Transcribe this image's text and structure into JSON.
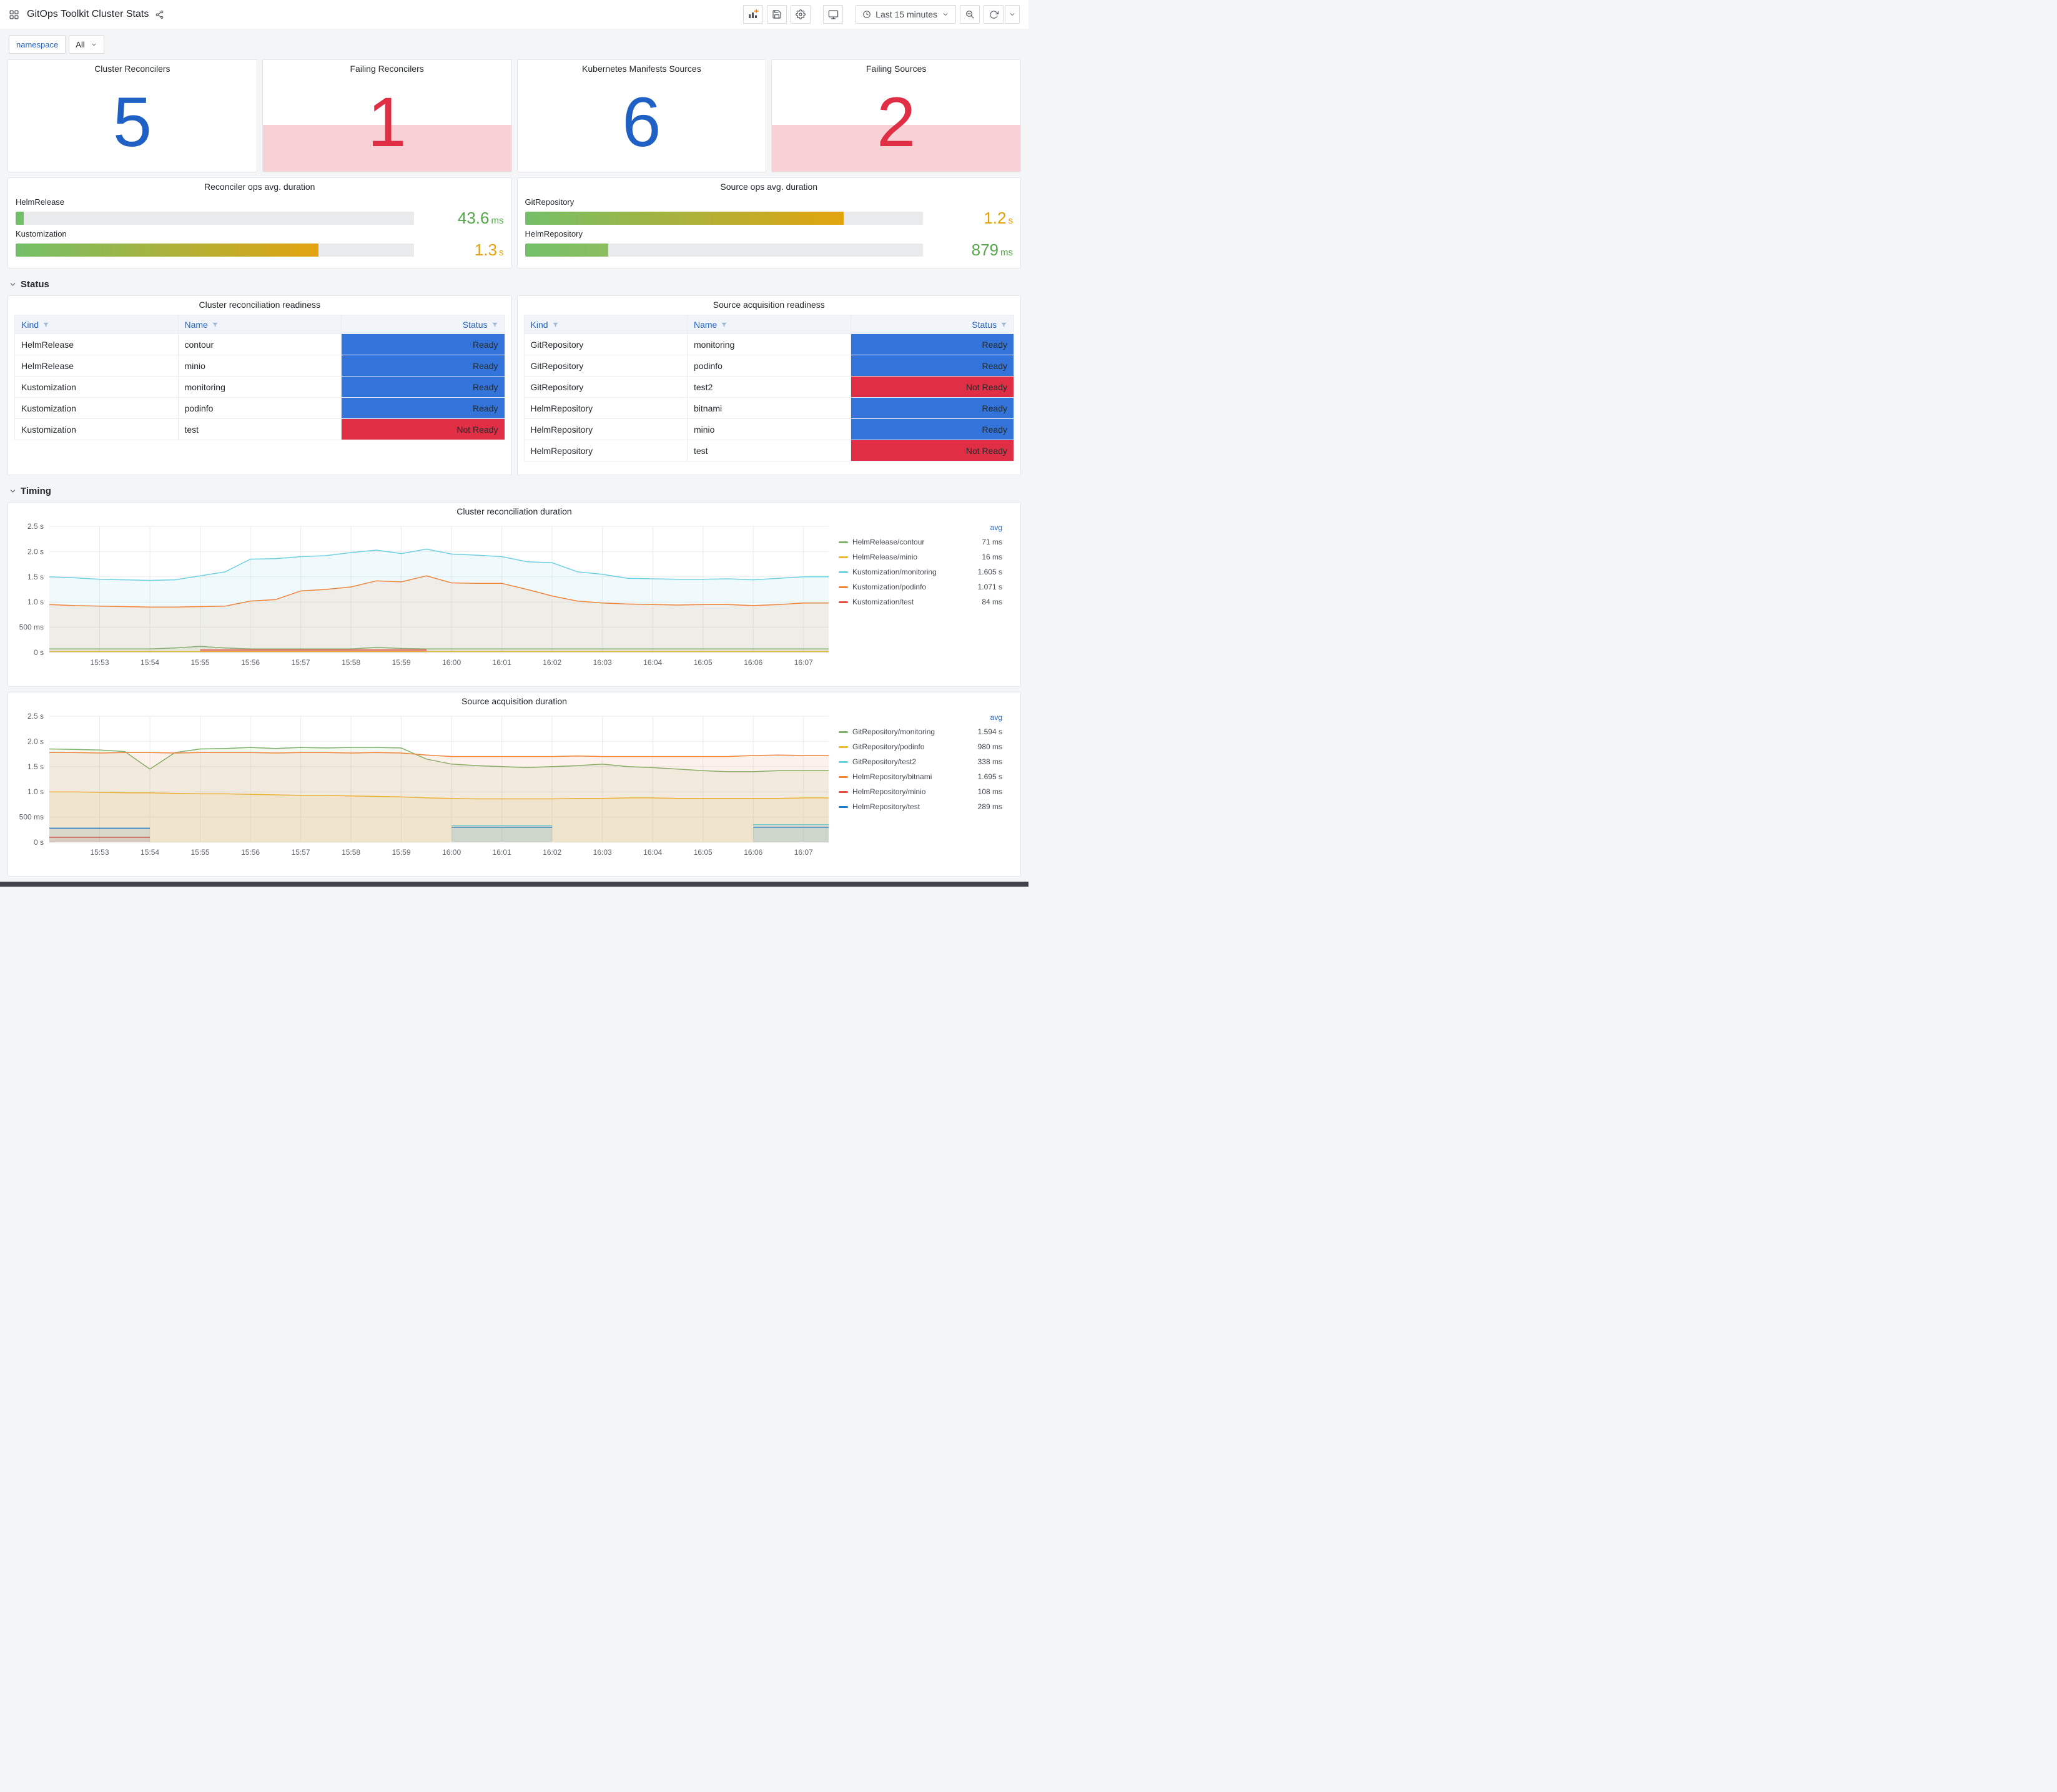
{
  "header": {
    "title": "GitOps Toolkit Cluster Stats",
    "time_range": "Last 15 minutes"
  },
  "variables": {
    "label": "namespace",
    "value": "All"
  },
  "sections": {
    "status": "Status",
    "timing": "Timing"
  },
  "colors": {
    "blue": "#1F60C4",
    "red": "#E02F44",
    "alert_band": "rgba(224,47,68,0.22)",
    "ready": "#3274D9",
    "not_ready": "#E02F44",
    "link_blue": "#1F62C4"
  },
  "stat_panels": [
    {
      "title": "Cluster Reconcilers",
      "value": "5",
      "status": "ok"
    },
    {
      "title": "Failing Reconcilers",
      "value": "1",
      "status": "alert"
    },
    {
      "title": "Kubernetes Manifests Sources",
      "value": "6",
      "status": "ok"
    },
    {
      "title": "Failing Sources",
      "value": "2",
      "status": "alert"
    }
  ],
  "gauge_panels": [
    {
      "title": "Reconciler ops avg. duration",
      "rows": [
        {
          "label": "HelmRelease",
          "value": "43.6",
          "unit": "ms",
          "percent": 2,
          "value_color": "#56A64B",
          "fill_from": "#73BF69",
          "fill_to": "#73BF69"
        },
        {
          "label": "Kustomization",
          "value": "1.3",
          "unit": "s",
          "percent": 76,
          "value_color": "#E5A10D",
          "fill_from": "#73BF69",
          "fill_to": "#E2A40E"
        }
      ]
    },
    {
      "title": "Source ops avg. duration",
      "rows": [
        {
          "label": "GitRepository",
          "value": "1.2",
          "unit": "s",
          "percent": 80,
          "value_color": "#E5A10D",
          "fill_from": "#73BF69",
          "fill_to": "#E2A40E"
        },
        {
          "label": "HelmRepository",
          "value": "879",
          "unit": "ms",
          "percent": 21,
          "value_color": "#56A64B",
          "fill_from": "#73BF69",
          "fill_to": "#8CBE5F"
        }
      ]
    }
  ],
  "tables": [
    {
      "title": "Cluster reconciliation readiness",
      "columns": [
        "Kind",
        "Name",
        "Status"
      ],
      "rows": [
        {
          "kind": "HelmRelease",
          "name": "contour",
          "status": "Ready"
        },
        {
          "kind": "HelmRelease",
          "name": "minio",
          "status": "Ready"
        },
        {
          "kind": "Kustomization",
          "name": "monitoring",
          "status": "Ready"
        },
        {
          "kind": "Kustomization",
          "name": "podinfo",
          "status": "Ready"
        },
        {
          "kind": "Kustomization",
          "name": "test",
          "status": "Not Ready"
        }
      ]
    },
    {
      "title": "Source acquisition readiness",
      "columns": [
        "Kind",
        "Name",
        "Status"
      ],
      "rows": [
        {
          "kind": "GitRepository",
          "name": "monitoring",
          "status": "Ready"
        },
        {
          "kind": "GitRepository",
          "name": "podinfo",
          "status": "Ready"
        },
        {
          "kind": "GitRepository",
          "name": "test2",
          "status": "Not Ready"
        },
        {
          "kind": "HelmRepository",
          "name": "bitnami",
          "status": "Ready"
        },
        {
          "kind": "HelmRepository",
          "name": "minio",
          "status": "Ready"
        },
        {
          "kind": "HelmRepository",
          "name": "test",
          "status": "Not Ready"
        }
      ]
    }
  ],
  "chart_data": [
    {
      "type": "line",
      "title": "Cluster reconciliation duration",
      "xlabel": "",
      "ylabel": "",
      "ylim": [
        0,
        2.5
      ],
      "x_span": 15.5,
      "x_first_tick": 1,
      "legend_header": "avg",
      "y_ticks": [
        {
          "v": 0,
          "label": "0 s"
        },
        {
          "v": 0.5,
          "label": "500 ms"
        },
        {
          "v": 1,
          "label": "1.0 s"
        },
        {
          "v": 1.5,
          "label": "1.5 s"
        },
        {
          "v": 2,
          "label": "2.0 s"
        },
        {
          "v": 2.5,
          "label": "2.5 s"
        }
      ],
      "x_ticks": [
        "15:53",
        "15:54",
        "15:55",
        "15:56",
        "15:57",
        "15:58",
        "15:59",
        "16:00",
        "16:01",
        "16:02",
        "16:03",
        "16:04",
        "16:05",
        "16:06",
        "16:07"
      ],
      "series": [
        {
          "name": "HelmRelease/contour",
          "avg": "71 ms",
          "color": "#7EB26D",
          "values": [
            0.07,
            0.07,
            0.07,
            0.07,
            0.07,
            0.09,
            0.12,
            0.09,
            0.07,
            0.07,
            0.07,
            0.07,
            0.07,
            0.1,
            0.08,
            0.07,
            0.07,
            0.07,
            0.07,
            0.07,
            0.07,
            0.07,
            0.07,
            0.07,
            0.07,
            0.07,
            0.07,
            0.07,
            0.07,
            0.07,
            0.07,
            0.07
          ]
        },
        {
          "name": "HelmRelease/minio",
          "avg": "16 ms",
          "color": "#EAB839",
          "values": [
            0.02,
            0.02,
            0.02,
            0.02,
            0.02,
            0.02,
            0.02,
            0.02,
            0.02,
            0.02,
            0.02,
            0.02,
            0.02,
            0.02,
            0.02,
            0.02,
            0.02,
            0.02,
            0.02,
            0.02,
            0.02,
            0.02,
            0.02,
            0.02,
            0.02,
            0.02,
            0.02,
            0.02,
            0.02,
            0.02,
            0.02,
            0.02
          ]
        },
        {
          "name": "Kustomization/monitoring",
          "avg": "1.605 s",
          "color": "#6ED0E0",
          "values": [
            1.5,
            1.48,
            1.45,
            1.44,
            1.43,
            1.44,
            1.52,
            1.6,
            1.85,
            1.86,
            1.9,
            1.92,
            1.98,
            2.03,
            1.96,
            2.05,
            1.95,
            1.93,
            1.9,
            1.8,
            1.78,
            1.6,
            1.55,
            1.47,
            1.46,
            1.45,
            1.45,
            1.46,
            1.44,
            1.47,
            1.5,
            1.5
          ]
        },
        {
          "name": "Kustomization/podinfo",
          "avg": "1.071 s",
          "color": "#EF843C",
          "values": [
            0.95,
            0.93,
            0.92,
            0.91,
            0.9,
            0.9,
            0.91,
            0.92,
            1.02,
            1.05,
            1.22,
            1.25,
            1.3,
            1.42,
            1.4,
            1.52,
            1.38,
            1.37,
            1.37,
            1.25,
            1.12,
            1.02,
            0.98,
            0.96,
            0.95,
            0.94,
            0.95,
            0.95,
            0.93,
            0.95,
            0.98,
            0.98
          ]
        },
        {
          "name": "Kustomization/test",
          "avg": "84 ms",
          "color": "#E24D42",
          "values": [
            null,
            null,
            null,
            null,
            null,
            null,
            0.05,
            0.05,
            0.05,
            0.05,
            0.05,
            0.05,
            0.05,
            0.05,
            0.05,
            0.05,
            null,
            null,
            null,
            null,
            null,
            null,
            null,
            null,
            null,
            null,
            null,
            null,
            null,
            null,
            null,
            null
          ]
        }
      ]
    },
    {
      "type": "line",
      "title": "Source acquisition duration",
      "xlabel": "",
      "ylabel": "",
      "ylim": [
        0,
        2.5
      ],
      "x_span": 15.5,
      "x_first_tick": 1,
      "legend_header": "avg",
      "y_ticks": [
        {
          "v": 0,
          "label": "0 s"
        },
        {
          "v": 0.5,
          "label": "500 ms"
        },
        {
          "v": 1,
          "label": "1.0 s"
        },
        {
          "v": 1.5,
          "label": "1.5 s"
        },
        {
          "v": 2,
          "label": "2.0 s"
        },
        {
          "v": 2.5,
          "label": "2.5 s"
        }
      ],
      "x_ticks": [
        "15:53",
        "15:54",
        "15:55",
        "15:56",
        "15:57",
        "15:58",
        "15:59",
        "16:00",
        "16:01",
        "16:02",
        "16:03",
        "16:04",
        "16:05",
        "16:06",
        "16:07"
      ],
      "series": [
        {
          "name": "GitRepository/monitoring",
          "avg": "1.594 s",
          "color": "#7EB26D",
          "values": [
            1.85,
            1.84,
            1.83,
            1.8,
            1.45,
            1.78,
            1.85,
            1.86,
            1.88,
            1.86,
            1.88,
            1.87,
            1.88,
            1.88,
            1.87,
            1.65,
            1.55,
            1.52,
            1.5,
            1.48,
            1.5,
            1.52,
            1.55,
            1.5,
            1.48,
            1.45,
            1.42,
            1.4,
            1.4,
            1.42,
            1.42,
            1.42
          ]
        },
        {
          "name": "GitRepository/podinfo",
          "avg": "980 ms",
          "color": "#EAB839",
          "values": [
            1.0,
            1.0,
            0.99,
            0.98,
            0.98,
            0.97,
            0.96,
            0.96,
            0.95,
            0.94,
            0.93,
            0.93,
            0.92,
            0.91,
            0.9,
            0.88,
            0.87,
            0.86,
            0.86,
            0.86,
            0.86,
            0.87,
            0.87,
            0.88,
            0.88,
            0.87,
            0.87,
            0.87,
            0.87,
            0.87,
            0.88,
            0.88
          ]
        },
        {
          "name": "GitRepository/test2",
          "avg": "338 ms",
          "color": "#6ED0E0",
          "values": [
            null,
            null,
            null,
            null,
            null,
            null,
            null,
            null,
            null,
            null,
            null,
            null,
            null,
            null,
            null,
            null,
            0.33,
            0.33,
            0.33,
            0.33,
            0.33,
            null,
            null,
            null,
            null,
            null,
            null,
            null,
            0.35,
            0.35,
            0.35,
            0.35
          ]
        },
        {
          "name": "HelmRepository/bitnami",
          "avg": "1.695 s",
          "color": "#EF843C",
          "values": [
            1.78,
            1.78,
            1.77,
            1.78,
            1.78,
            1.77,
            1.78,
            1.78,
            1.78,
            1.77,
            1.78,
            1.78,
            1.77,
            1.78,
            1.77,
            1.73,
            1.7,
            1.7,
            1.7,
            1.7,
            1.7,
            1.71,
            1.7,
            1.7,
            1.7,
            1.7,
            1.7,
            1.7,
            1.72,
            1.73,
            1.72,
            1.72
          ]
        },
        {
          "name": "HelmRepository/minio",
          "avg": "108 ms",
          "color": "#E24D42",
          "values": [
            0.1,
            0.1,
            0.1,
            0.1,
            0.1,
            null,
            null,
            null,
            null,
            null,
            null,
            null,
            null,
            null,
            null,
            null,
            null,
            null,
            null,
            null,
            null,
            null,
            null,
            null,
            null,
            null,
            null,
            null,
            null,
            null,
            null,
            null
          ]
        },
        {
          "name": "HelmRepository/test",
          "avg": "289 ms",
          "color": "#1F78C1",
          "values": [
            0.28,
            0.28,
            0.28,
            0.28,
            0.28,
            null,
            null,
            null,
            null,
            null,
            null,
            null,
            null,
            null,
            null,
            null,
            0.3,
            0.3,
            0.3,
            0.3,
            0.3,
            null,
            null,
            null,
            null,
            null,
            null,
            null,
            0.3,
            0.3,
            0.3,
            0.3
          ]
        }
      ]
    }
  ]
}
